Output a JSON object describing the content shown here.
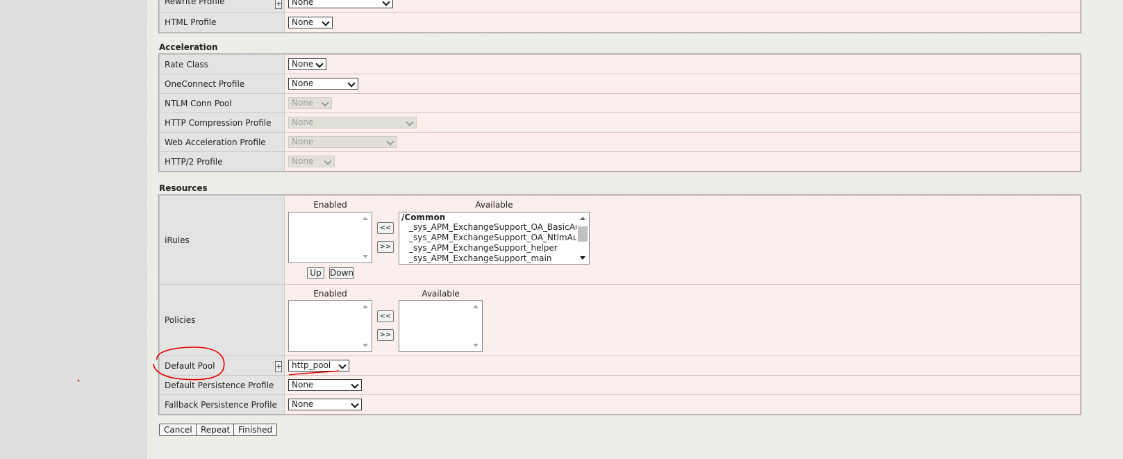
{
  "rewrite_profile": {
    "label": "Rewrite Profile",
    "value": "None"
  },
  "html_profile": {
    "label": "HTML Profile",
    "value": "None"
  },
  "acceleration": {
    "title": "Acceleration",
    "rate_class": {
      "label": "Rate Class",
      "value": "None"
    },
    "oneconnect": {
      "label": "OneConnect Profile",
      "value": "None"
    },
    "ntlm": {
      "label": "NTLM Conn Pool",
      "value": "None"
    },
    "http_compression": {
      "label": "HTTP Compression Profile",
      "value": "None"
    },
    "web_acceleration": {
      "label": "Web Acceleration Profile",
      "value": "None"
    },
    "http2": {
      "label": "HTTP/2 Profile",
      "value": "None"
    }
  },
  "resources": {
    "title": "Resources",
    "irules": {
      "label": "iRules",
      "enabled_header": "Enabled",
      "available_header": "Available",
      "group": "/Common",
      "available": [
        "_sys_APM_ExchangeSupport_OA_BasicAuth",
        "_sys_APM_ExchangeSupport_OA_NtlmAuth",
        "_sys_APM_ExchangeSupport_helper",
        "_sys_APM_ExchangeSupport_main"
      ],
      "move_left": "<<",
      "move_right": ">>",
      "up": "Up",
      "down": "Down"
    },
    "policies": {
      "label": "Policies",
      "enabled_header": "Enabled",
      "available_header": "Available",
      "move_left": "<<",
      "move_right": ">>"
    },
    "default_pool": {
      "label": "Default Pool",
      "plus": "+",
      "value": "http_pool"
    },
    "default_persistence": {
      "label": "Default Persistence Profile",
      "value": "None"
    },
    "fallback_persistence": {
      "label": "Fallback Persistence Profile",
      "value": "None"
    }
  },
  "plus_label": "+",
  "buttons": {
    "cancel": "Cancel",
    "repeat": "Repeat",
    "finished": "Finished"
  },
  "colors": {
    "row_bg": "#fdeeee",
    "label_bg": "#e3e3e3",
    "annotation": "#e00000"
  }
}
